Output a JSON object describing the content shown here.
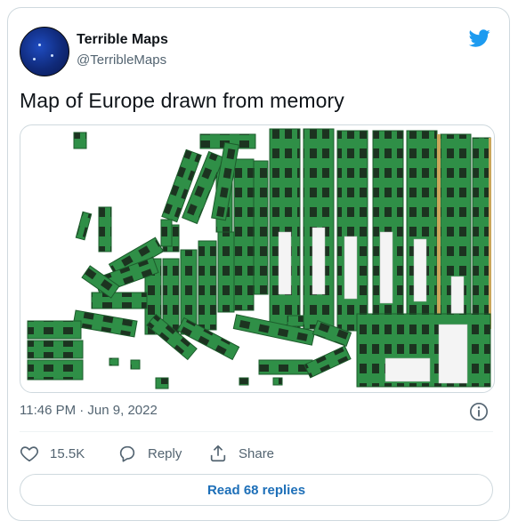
{
  "tweet": {
    "author_name": "Terrible Maps",
    "author_handle": "@TerribleMaps",
    "text": "Map of Europe drawn from memory",
    "timestamp": "11:46 PM · Jun 9, 2022",
    "likes": "15.5K",
    "reply_label": "Reply",
    "share_label": "Share",
    "read_replies_label": "Read 68 replies"
  },
  "icons": {
    "brand": "twitter-bird-icon",
    "info": "info-icon",
    "like": "heart-icon",
    "reply": "speech-bubble-icon",
    "share": "share-upload-icon"
  },
  "colors": {
    "twitter_blue": "#1d9bf0",
    "link_blue": "#1d6fb8",
    "secondary_text": "#536471",
    "ram_green": "#2f8f47",
    "ram_chip": "#1c3320",
    "ram_gold": "#c9a65a"
  }
}
